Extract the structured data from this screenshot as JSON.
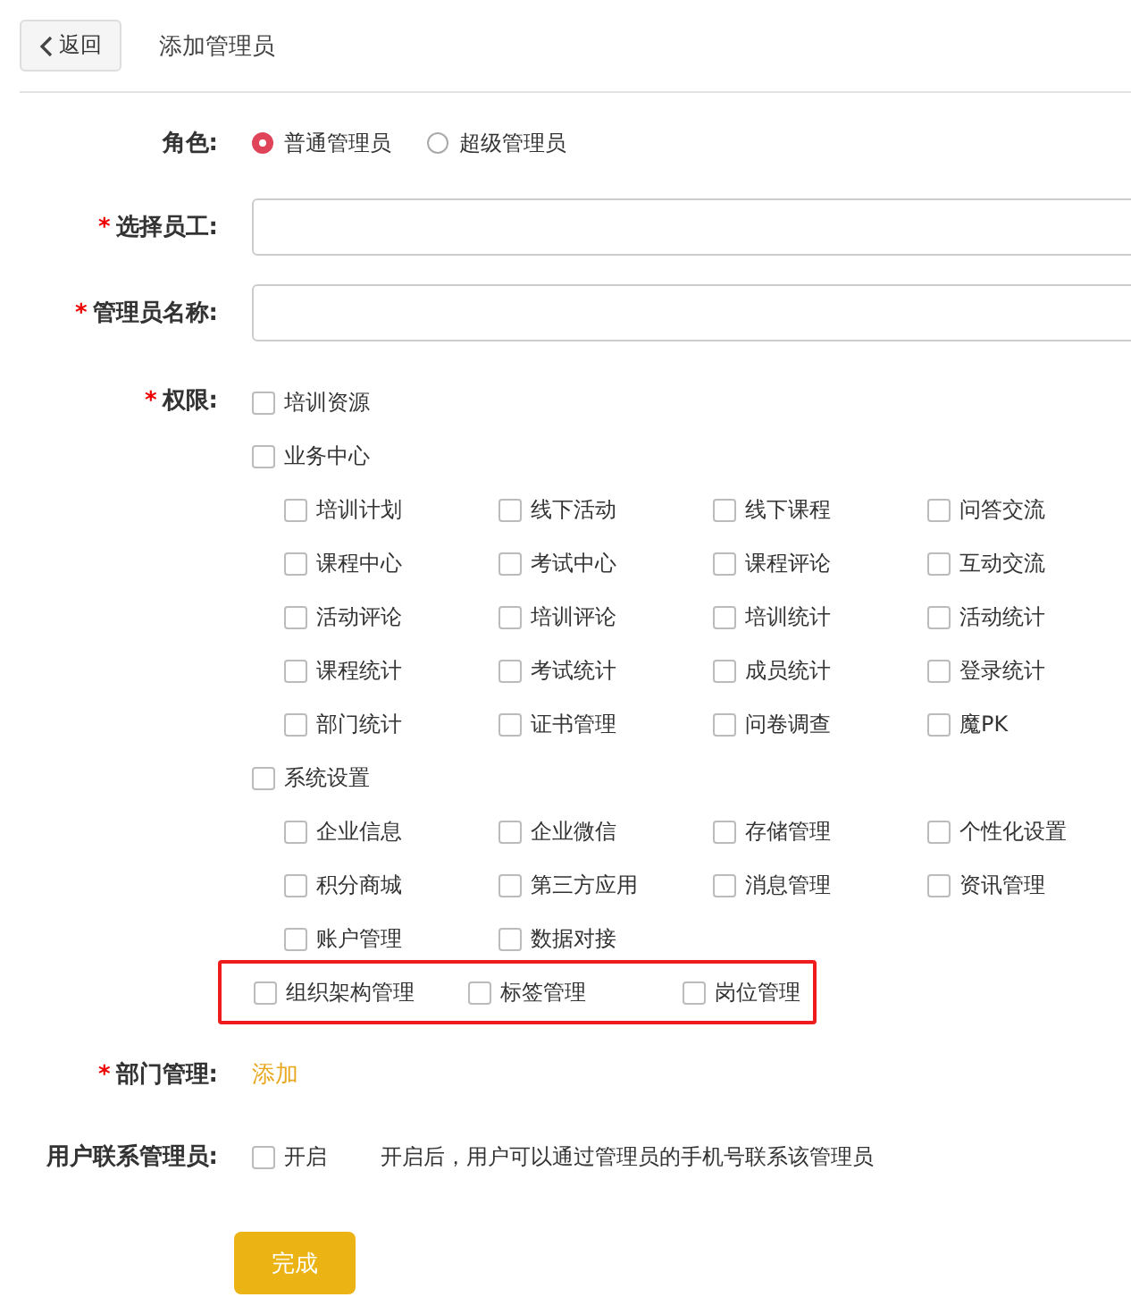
{
  "header": {
    "back_button": "返回",
    "title": "添加管理员"
  },
  "role": {
    "label": "角色:",
    "options": [
      {
        "label": "普通管理员",
        "selected": true
      },
      {
        "label": "超级管理员",
        "selected": false
      }
    ]
  },
  "fields": [
    {
      "mark": "*",
      "label": "选择员工:"
    },
    {
      "mark": "*",
      "label": "管理员名称:"
    }
  ],
  "permissions": {
    "mark": "*",
    "label": "权限:",
    "groups": [
      {
        "label": "培训资源",
        "checked": false
      },
      {
        "label": "业务中心",
        "checked": false,
        "children": [
          {
            "label": "培训计划",
            "checked": false
          },
          {
            "label": "线下活动",
            "checked": false
          },
          {
            "label": "线下课程",
            "checked": false
          },
          {
            "label": "问答交流",
            "checked": false
          },
          {
            "label": "课程中心",
            "checked": false
          },
          {
            "label": "考试中心",
            "checked": false
          },
          {
            "label": "课程评论",
            "checked": false
          },
          {
            "label": "互动交流",
            "checked": false
          },
          {
            "label": "活动评论",
            "checked": false
          },
          {
            "label": "培训评论",
            "checked": false
          },
          {
            "label": "培训统计",
            "checked": false
          },
          {
            "label": "活动统计",
            "checked": false
          },
          {
            "label": "课程统计",
            "checked": false
          },
          {
            "label": "考试统计",
            "checked": false
          },
          {
            "label": "成员统计",
            "checked": false
          },
          {
            "label": "登录统计",
            "checked": false
          },
          {
            "label": "部门统计",
            "checked": false
          },
          {
            "label": "证书管理",
            "checked": false
          },
          {
            "label": "问卷调查",
            "checked": false
          },
          {
            "label": "魔PK",
            "checked": false
          }
        ]
      },
      {
        "label": "系统设置",
        "checked": false,
        "children": [
          {
            "label": "企业信息",
            "checked": false
          },
          {
            "label": "企业微信",
            "checked": false
          },
          {
            "label": "存储管理",
            "checked": false
          },
          {
            "label": "个性化设置",
            "checked": false
          },
          {
            "label": "积分商城",
            "checked": false
          },
          {
            "label": "第三方应用",
            "checked": false
          },
          {
            "label": "消息管理",
            "checked": false
          },
          {
            "label": "资讯管理",
            "checked": false
          },
          {
            "label": "账户管理",
            "checked": false
          },
          {
            "label": "数据对接",
            "checked": false
          }
        ]
      }
    ],
    "highlighted": [
      {
        "label": "组织架构管理",
        "checked": false
      },
      {
        "label": "标签管理",
        "checked": false
      },
      {
        "label": "岗位管理",
        "checked": false
      }
    ]
  },
  "department": {
    "mark": "*",
    "label": "部门管理:",
    "link": "添加"
  },
  "contact": {
    "label": "用户联系管理员:",
    "option": {
      "label": "开启",
      "checked": false
    },
    "hint": "开启后，用户可以通过管理员的手机号联系该管理员"
  },
  "submit": "完成"
}
